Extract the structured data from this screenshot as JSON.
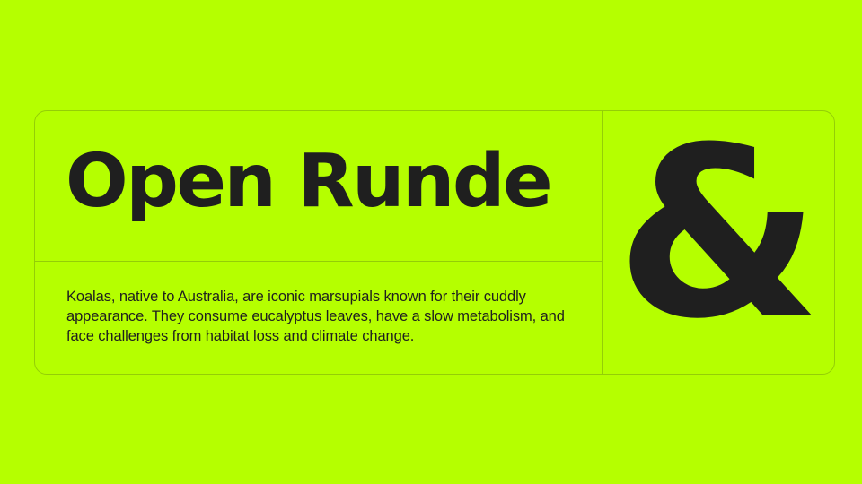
{
  "specimen": {
    "title": "Open Runde",
    "description": "Koalas, native to Australia, are iconic marsupials known for their cuddly appearance. They consume eucalyptus leaves, have a slow metabolism, and face challenges from habitat loss and climate change.",
    "glyph": "&"
  },
  "colors": {
    "background": "#b5ff00",
    "text": "#1f1f1f"
  }
}
